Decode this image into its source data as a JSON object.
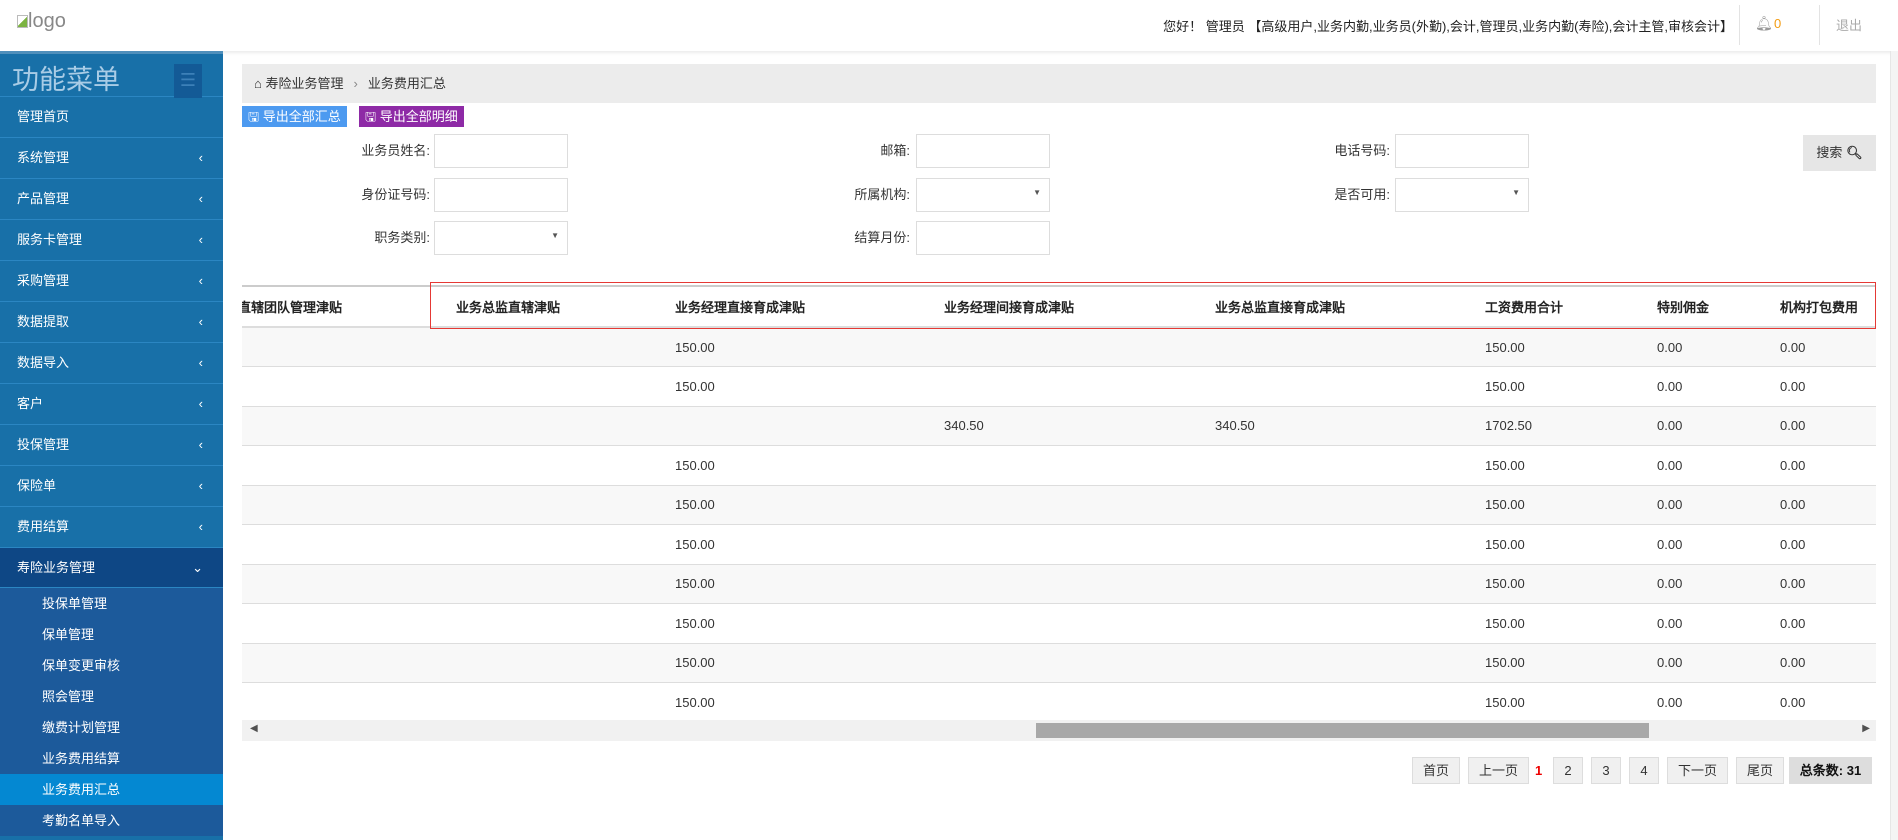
{
  "header": {
    "logo_alt": "logo",
    "greeting": "您好！ 管理员 【高级用户,业务内勤,业务员(外勤),会计,管理员,业务内勤(寿险),会计主管,审核会计】",
    "notification_count": "0",
    "logout": "退出"
  },
  "sidebar": {
    "title": "功能菜单",
    "items": [
      {
        "label": "管理首页"
      },
      {
        "label": "系统管理"
      },
      {
        "label": "产品管理"
      },
      {
        "label": "服务卡管理"
      },
      {
        "label": "采购管理"
      },
      {
        "label": "数据提取"
      },
      {
        "label": "数据导入"
      },
      {
        "label": "客户"
      },
      {
        "label": "投保管理"
      },
      {
        "label": "保险单"
      },
      {
        "label": "费用结算"
      },
      {
        "label": "寿险业务管理"
      }
    ],
    "subitems": [
      {
        "label": "投保单管理"
      },
      {
        "label": "保单管理"
      },
      {
        "label": "保单变更审核"
      },
      {
        "label": "照会管理"
      },
      {
        "label": "缴费计划管理"
      },
      {
        "label": "业务费用结算"
      },
      {
        "label": "业务费用汇总"
      },
      {
        "label": "考勤名单导入"
      }
    ]
  },
  "breadcrumb": {
    "parent": "寿险业务管理",
    "current": "业务费用汇总"
  },
  "actions": {
    "export_summary": "导出全部汇总",
    "export_detail": "导出全部明细"
  },
  "filters": {
    "name": "业务员姓名:",
    "email": "邮箱:",
    "phone": "电话号码:",
    "id_no": "身份证号码:",
    "org": "所属机构:",
    "enabled": "是否可用:",
    "position": "职务类别:",
    "month": "结算月份:",
    "search": "搜索"
  },
  "table": {
    "columns": [
      "直辖团队管理津贴",
      "业务总监直辖津贴",
      "业务经理直接育成津贴",
      "业务经理间接育成津贴",
      "业务总监直接育成津贴",
      "工资费用合计",
      "特别佣金",
      "机构打包费用"
    ],
    "rows": [
      [
        "",
        "",
        "150.00",
        "",
        "",
        "150.00",
        "0.00",
        "0.00"
      ],
      [
        "",
        "",
        "150.00",
        "",
        "",
        "150.00",
        "0.00",
        "0.00"
      ],
      [
        "",
        "",
        "",
        "340.50",
        "340.50",
        "1702.50",
        "0.00",
        "0.00"
      ],
      [
        "",
        "",
        "150.00",
        "",
        "",
        "150.00",
        "0.00",
        "0.00"
      ],
      [
        "",
        "",
        "150.00",
        "",
        "",
        "150.00",
        "0.00",
        "0.00"
      ],
      [
        "",
        "",
        "150.00",
        "",
        "",
        "150.00",
        "0.00",
        "0.00"
      ],
      [
        "",
        "",
        "150.00",
        "",
        "",
        "150.00",
        "0.00",
        "0.00"
      ],
      [
        "",
        "",
        "150.00",
        "",
        "",
        "150.00",
        "0.00",
        "0.00"
      ],
      [
        "",
        "",
        "150.00",
        "",
        "",
        "150.00",
        "0.00",
        "0.00"
      ],
      [
        "",
        "",
        "150.00",
        "",
        "",
        "150.00",
        "0.00",
        "0.00"
      ]
    ]
  },
  "pagination": {
    "first": "首页",
    "prev": "上一页",
    "current": "1",
    "pages": [
      "2",
      "3",
      "4"
    ],
    "next": "下一页",
    "last": "尾页",
    "total": "总条数: 31"
  },
  "colors": {
    "sidebar": "#1870a8",
    "active_parent": "#0e4785",
    "active_sub": "#0488d2",
    "export_summary": "#4d9af0",
    "export_detail": "#8e2aa6",
    "highlight": "#e53935"
  }
}
